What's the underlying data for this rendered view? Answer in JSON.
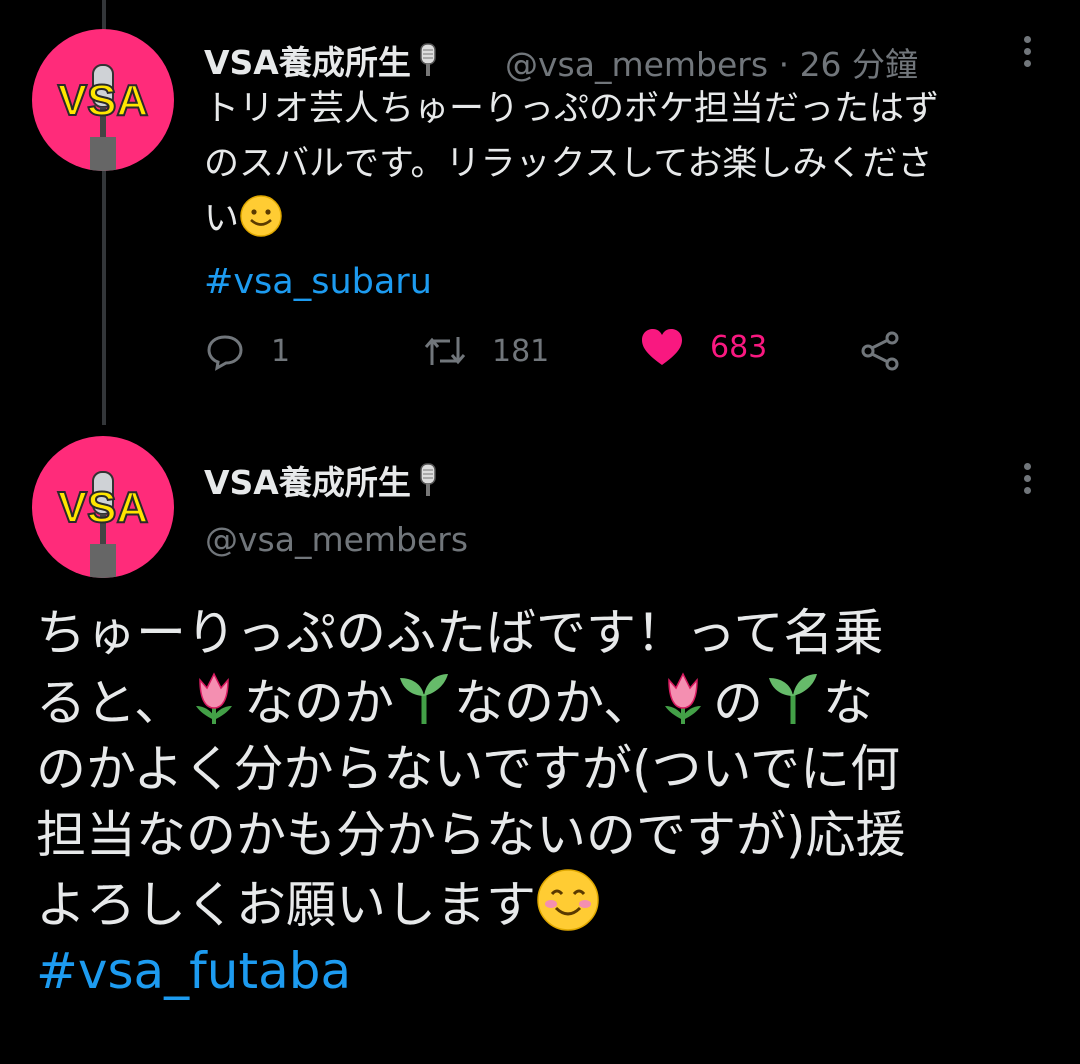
{
  "tweet1": {
    "display_name": "VSA養成所生",
    "handle": "@vsa_members",
    "separator": "·",
    "time": "26 分鐘",
    "text_line1": "トリオ芸人ちゅーりっぷのボケ担当だったはず",
    "text_line2": "のスバルです。リラックスしてお楽しみくださ",
    "text_line3": "い",
    "hashtag": "#vsa_subaru",
    "reply_count": "1",
    "retweet_count": "181",
    "like_count": "683",
    "icons": [
      "reply-icon",
      "retweet-icon",
      "heart-icon",
      "share-icon",
      "more-icon",
      "microphone-icon",
      "smile-emoji"
    ]
  },
  "tweet2": {
    "display_name": "VSA養成所生",
    "handle": "@vsa_members",
    "seg1": "ちゅーりっぷのふたばです！って名乗",
    "seg2": "ると、",
    "seg3": "なのか",
    "seg4": "なのか、",
    "seg5": "の",
    "seg6": "な",
    "seg7": "のかよく分からないですが(ついでに何",
    "seg8": "担当なのかも分からないのですが)応援",
    "seg9": "よろしくお願いします",
    "hashtag": "#vsa_futaba",
    "icons": [
      "tulip-emoji",
      "seedling-emoji",
      "blush-emoji",
      "more-icon",
      "microphone-icon"
    ]
  },
  "avatar_text": "VSA",
  "colors": {
    "background": "#000000",
    "avatar": "#ff2b7a",
    "avatar_text": "#ffe600",
    "link": "#1d9bf0",
    "like": "#f91880",
    "muted": "#71767b"
  }
}
